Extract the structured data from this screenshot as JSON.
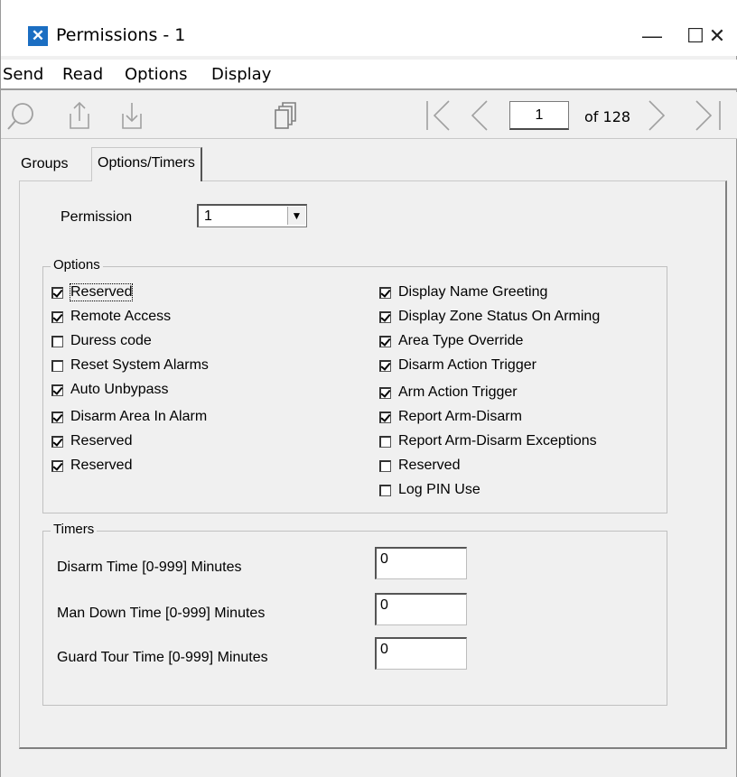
{
  "window": {
    "title": "Permissions - 1",
    "controls": {
      "minimize": "—",
      "maximize": "☐",
      "close": "✕"
    }
  },
  "menu": [
    "Send",
    "Read",
    "Options",
    "Display"
  ],
  "toolbar": {
    "icons": [
      "search-icon",
      "upload-icon",
      "download-icon",
      "copy-icon",
      "first-page-icon",
      "previous-page-icon",
      "next-page-icon",
      "last-page-icon"
    ],
    "page_current": "1",
    "page_total_label": "of 128"
  },
  "tabs": [
    {
      "label": "Groups",
      "active": false
    },
    {
      "label": "Options/Timers",
      "active": true
    }
  ],
  "permission": {
    "label": "Permission",
    "value": "1"
  },
  "options": {
    "title": "Options",
    "left": [
      {
        "label": "Reserved",
        "checked": true
      },
      {
        "label": "Remote Access",
        "checked": true
      },
      {
        "label": "Duress code",
        "checked": false
      },
      {
        "label": "Reset System Alarms",
        "checked": false
      },
      {
        "label": "Auto Unbypass",
        "checked": true
      },
      {
        "label": "Disarm Area In Alarm",
        "checked": true
      },
      {
        "label": "Reserved",
        "checked": true
      },
      {
        "label": "Reserved",
        "checked": true
      }
    ],
    "right": [
      {
        "label": "Display Name Greeting",
        "checked": true
      },
      {
        "label": "Display Zone Status On Arming",
        "checked": true
      },
      {
        "label": "Area Type Override",
        "checked": true
      },
      {
        "label": "Disarm Action Trigger",
        "checked": true
      },
      {
        "label": "Arm Action Trigger",
        "checked": true
      },
      {
        "label": "Report Arm-Disarm",
        "checked": true
      },
      {
        "label": "Report Arm-Disarm Exceptions",
        "checked": false
      },
      {
        "label": "Reserved",
        "checked": false
      },
      {
        "label": "Log PIN Use",
        "checked": false
      }
    ]
  },
  "timers": {
    "title": "Timers",
    "items": [
      {
        "label": "Disarm Time [0-999] Minutes",
        "value": "0"
      },
      {
        "label": "Man Down Time [0-999] Minutes",
        "value": "0"
      },
      {
        "label": "Guard Tour Time  [0-999] Minutes",
        "value": "0"
      }
    ]
  }
}
